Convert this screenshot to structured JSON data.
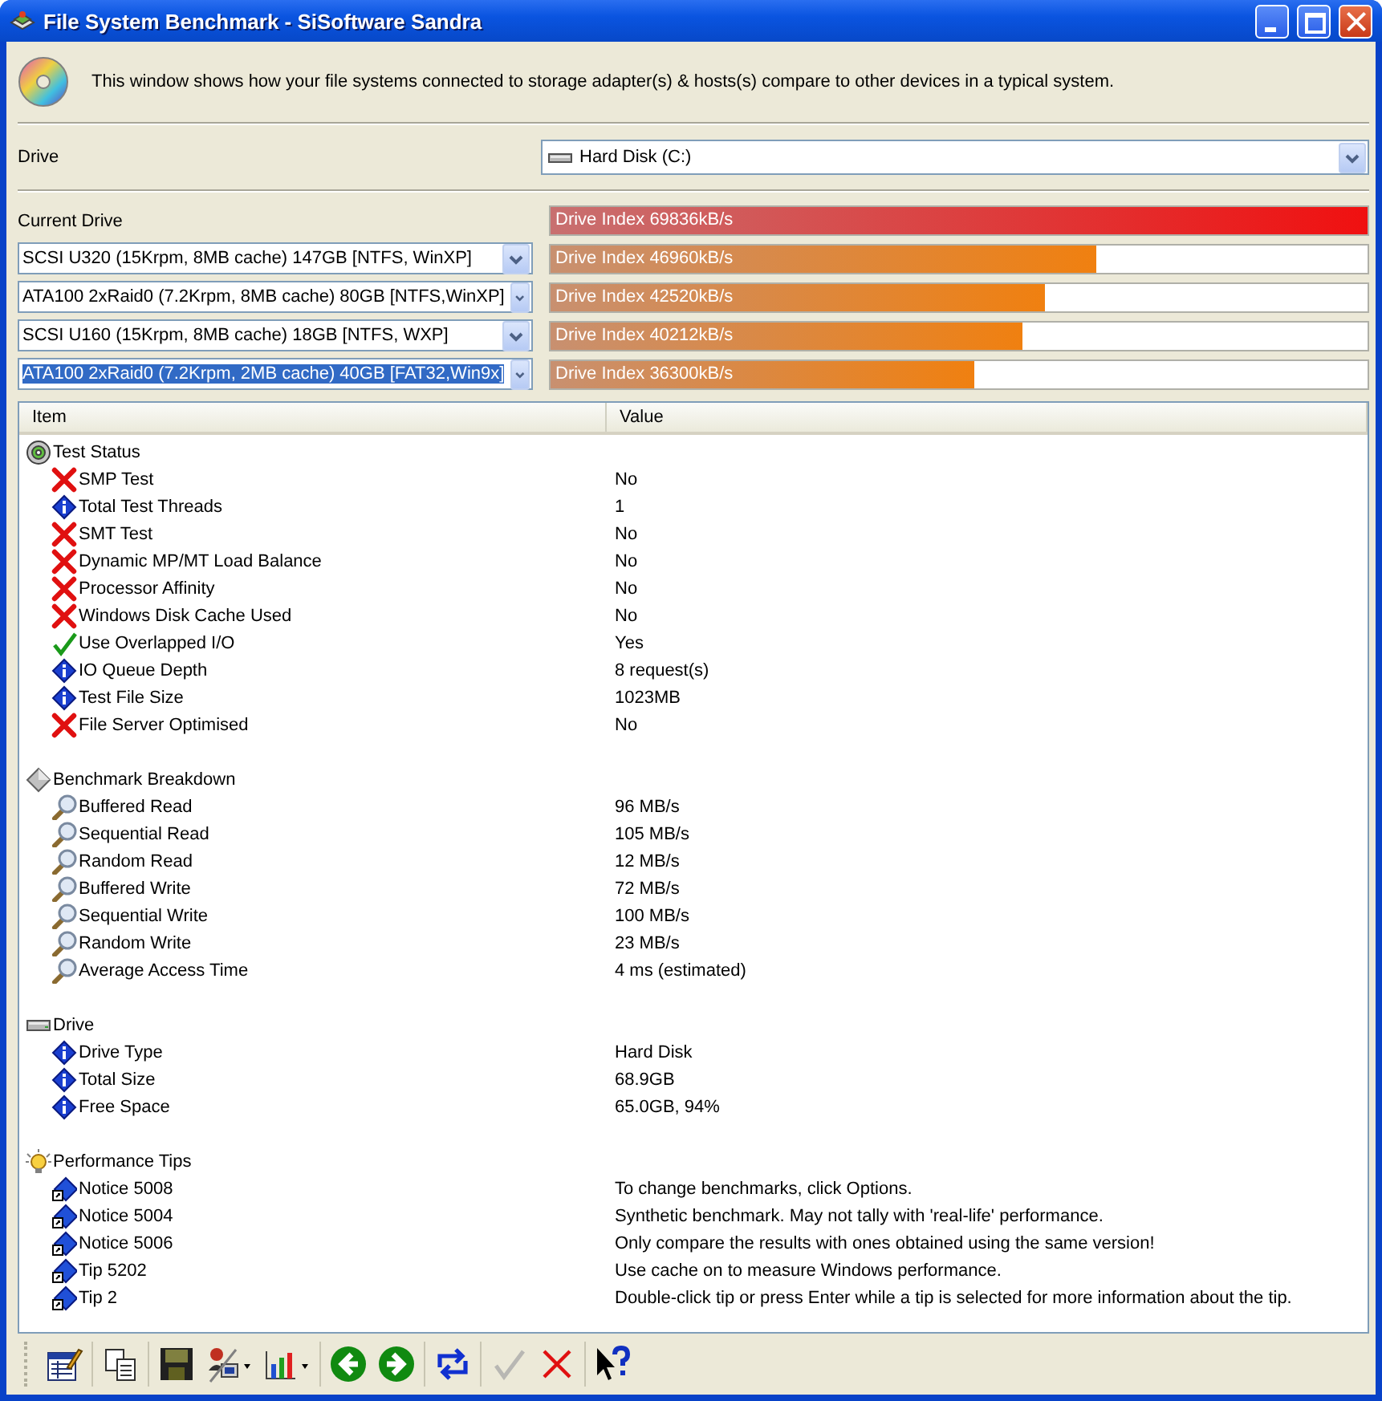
{
  "window": {
    "title": "File System Benchmark - SiSoftware Sandra"
  },
  "description": "This window shows how your file systems connected to storage adapter(s) & hosts(s) compare to other devices in a typical system.",
  "drive": {
    "label": "Drive",
    "value": "Hard Disk (C:)"
  },
  "current_drive": {
    "label": "Current Drive",
    "reading": "Drive Index 69836kB/s",
    "level": 1.0
  },
  "comparisons": [
    {
      "device": "SCSI U320 (15Krpm, 8MB cache) 147GB [NTFS, WinXP]",
      "selected": false,
      "reading": "Drive Index 46960kB/s",
      "level": 0.667
    },
    {
      "device": "ATA100 2xRaid0 (7.2Krpm, 8MB cache) 80GB [NTFS,WinXP]",
      "selected": false,
      "reading": "Drive Index 42520kB/s",
      "level": 0.606
    },
    {
      "device": "SCSI U160 (15Krpm, 8MB cache) 18GB [NTFS, WXP]",
      "selected": false,
      "reading": "Drive Index 40212kB/s",
      "level": 0.577
    },
    {
      "device": "ATA100 2xRaid0 (7.2Krpm, 2MB cache) 40GB [FAT32,Win9x]",
      "selected": true,
      "reading": "Drive Index 36300kB/s",
      "level": 0.518
    }
  ],
  "list": {
    "columns": [
      "Item",
      "Value"
    ],
    "groups": [
      {
        "name": "Test Status",
        "kind": "status",
        "items": [
          {
            "name": "SMP Test",
            "kind": "cross",
            "value": "No"
          },
          {
            "name": "Total Test Threads",
            "kind": "info",
            "value": "1"
          },
          {
            "name": "SMT Test",
            "kind": "cross",
            "value": "No"
          },
          {
            "name": "Dynamic MP/MT Load Balance",
            "kind": "cross",
            "value": "No"
          },
          {
            "name": "Processor Affinity",
            "kind": "cross",
            "value": "No"
          },
          {
            "name": "Windows Disk Cache Used",
            "kind": "cross",
            "value": "No"
          },
          {
            "name": "Use Overlapped I/O",
            "kind": "check",
            "value": "Yes"
          },
          {
            "name": "IO Queue Depth",
            "kind": "info",
            "value": "8 request(s)"
          },
          {
            "name": "Test File Size",
            "kind": "info",
            "value": "1023MB"
          },
          {
            "name": "File Server Optimised",
            "kind": "cross",
            "value": "No"
          }
        ]
      },
      {
        "name": "Benchmark Breakdown",
        "kind": "breakdown",
        "items": [
          {
            "name": "Buffered Read",
            "kind": "measure",
            "value": "96 MB/s"
          },
          {
            "name": "Sequential Read",
            "kind": "measure",
            "value": "105 MB/s"
          },
          {
            "name": "Random Read",
            "kind": "measure",
            "value": "12 MB/s"
          },
          {
            "name": "Buffered Write",
            "kind": "measure",
            "value": "72 MB/s"
          },
          {
            "name": "Sequential Write",
            "kind": "measure",
            "value": "100 MB/s"
          },
          {
            "name": "Random Write",
            "kind": "measure",
            "value": "23 MB/s"
          },
          {
            "name": "Average Access Time",
            "kind": "measure",
            "value": "4 ms (estimated)"
          }
        ]
      },
      {
        "name": "Drive",
        "kind": "drive",
        "items": [
          {
            "name": "Drive Type",
            "kind": "info",
            "value": "Hard Disk"
          },
          {
            "name": "Total Size",
            "kind": "info",
            "value": "68.9GB"
          },
          {
            "name": "Free Space",
            "kind": "info",
            "value": "65.0GB, 94%"
          }
        ]
      },
      {
        "name": "Performance Tips",
        "kind": "tips",
        "items": [
          {
            "name": "Notice 5008",
            "kind": "tip",
            "value": "To change benchmarks, click Options."
          },
          {
            "name": "Notice 5004",
            "kind": "tip",
            "value": "Synthetic benchmark. May not tally with 'real-life' performance."
          },
          {
            "name": "Notice 5006",
            "kind": "tip",
            "value": "Only compare the results with ones obtained using the same version!"
          },
          {
            "name": "Tip 5202",
            "kind": "tip",
            "value": "Use cache on to measure Windows performance."
          },
          {
            "name": "Tip 2",
            "kind": "tip",
            "value": "Double-click tip or press Enter while a tip is selected for more information about the tip."
          }
        ]
      }
    ]
  },
  "toolbar": {
    "groups": [
      {
        "buttons": [
          {
            "kind": "report",
            "disabled": false
          }
        ]
      },
      {
        "buttons": [
          {
            "kind": "copy",
            "disabled": false
          }
        ]
      },
      {
        "buttons": [
          {
            "kind": "save",
            "disabled": false
          },
          {
            "kind": "ownership",
            "disabled": false
          },
          {
            "kind": "chart",
            "disabled": false
          }
        ]
      },
      {
        "buttons": [
          {
            "kind": "back",
            "disabled": false
          },
          {
            "kind": "forward",
            "disabled": false
          }
        ]
      },
      {
        "buttons": [
          {
            "kind": "refresh",
            "disabled": false
          }
        ]
      },
      {
        "buttons": [
          {
            "kind": "ok",
            "disabled": true
          },
          {
            "kind": "cancel",
            "disabled": false
          }
        ]
      },
      {
        "buttons": [
          {
            "kind": "help",
            "disabled": false
          }
        ]
      }
    ]
  }
}
